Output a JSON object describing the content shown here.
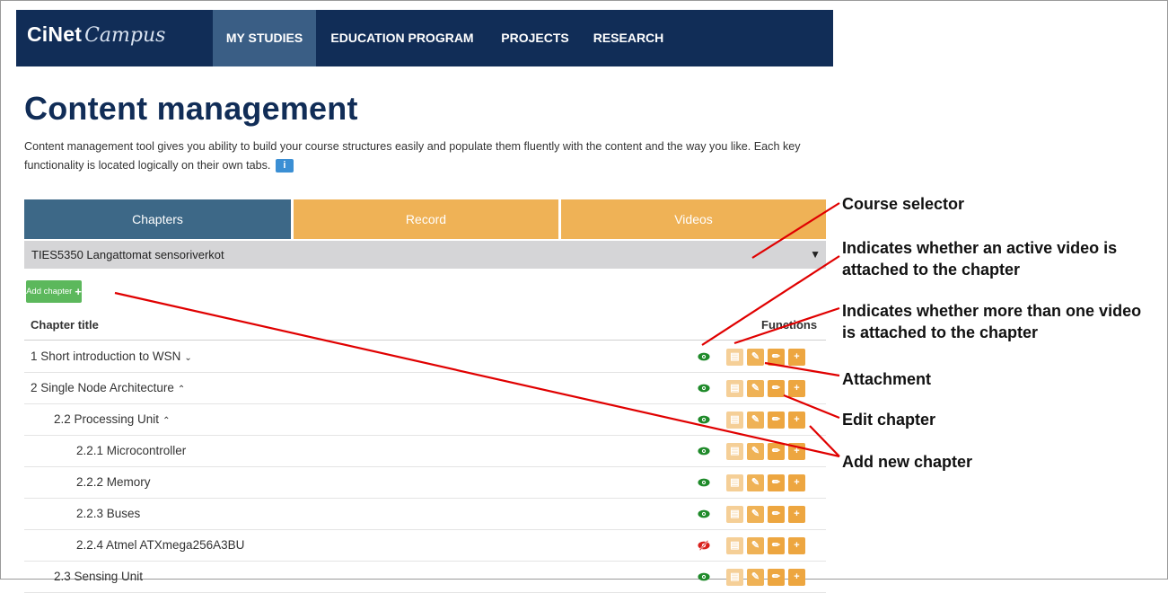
{
  "nav": {
    "logo_main": "CiNet",
    "logo_sub": "Campus",
    "items": [
      "MY STUDIES",
      "EDUCATION PROGRAM",
      "PROJECTS",
      "RESEARCH"
    ]
  },
  "page": {
    "title": "Content management",
    "description": "Content management tool gives you ability to build your course structures easily and populate them fluently with the content and the way you like. Each key functionality is located logically on their own tabs.",
    "info_icon": "i"
  },
  "tabs": [
    "Chapters",
    "Record",
    "Videos"
  ],
  "course_selector": {
    "value": "TIES5350 Langattomat sensoriverkot",
    "arrow": "▼"
  },
  "add_chapter": {
    "label": "Add chapter",
    "icon": "+"
  },
  "table": {
    "col_title": "Chapter title",
    "col_functions": "Functions",
    "rows": [
      {
        "title": "1 Short introduction to WSN",
        "chevron": "⌄",
        "eye": "active"
      },
      {
        "title": "2 Single Node Architecture",
        "chevron": "⌃",
        "eye": "active"
      },
      {
        "title": "2.2 Processing Unit",
        "chevron": "⌃",
        "eye": "active"
      },
      {
        "title": "2.2.1 Microcontroller",
        "chevron": "",
        "eye": "active"
      },
      {
        "title": "2.2.2 Memory",
        "chevron": "",
        "eye": "active"
      },
      {
        "title": "2.2.3 Buses",
        "chevron": "",
        "eye": "active"
      },
      {
        "title": "2.2.4 Atmel ATXmega256A3BU",
        "chevron": "",
        "eye": "inactive"
      },
      {
        "title": "2.3 Sensing Unit",
        "chevron": "",
        "eye": "active"
      }
    ]
  },
  "annotations": {
    "course_selector": "Course selector",
    "active_video": "Indicates whether an active video is attached to the chapter",
    "multiple_videos": "Indicates whether more than one video is attached to the chapter",
    "attachment": "Attachment",
    "edit_chapter": "Edit chapter",
    "add_new_chapter": "Add new chapter"
  },
  "colors": {
    "nav_bg": "#112d57",
    "tab_active": "#3d6887",
    "tab_orange": "#efb256",
    "add_green": "#5cb85c",
    "eye_active": "#1f8a2a",
    "eye_inactive": "#d9201c",
    "annotation_line": "#e00000"
  }
}
